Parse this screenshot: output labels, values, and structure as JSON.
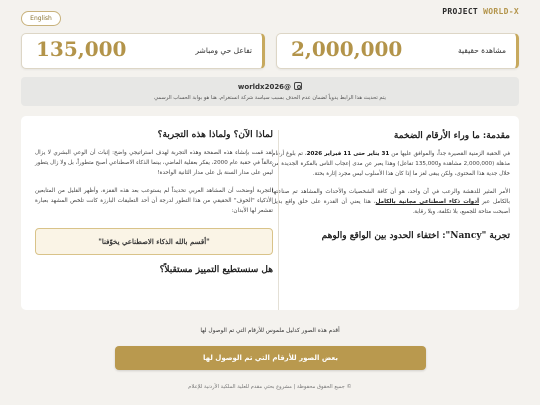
{
  "header": {
    "language_button": "English",
    "brand_part1": "PROJECT ",
    "brand_part2": "WORLD-X"
  },
  "stats": [
    {
      "number": "2,000,000",
      "label": "مشاهدة حقيقية"
    },
    {
      "number": "135,000",
      "label": "تفاعل حي ومباشر"
    }
  ],
  "instagram": {
    "handle": "worldx2026@",
    "note": "يتم تحديث هذا الرابط يدوياً لضمان عدم الحذف بسبب سياسة شركة انستغرام. هنا هو بوابة الحساب الرسمي"
  },
  "article": {
    "section1_title": "مقدمة: ما وراء الأرقام الضخمة",
    "section1_p1_a": "في الحقبة الزمنية القصيرة جداً، والموافق عليها من ",
    "section1_p1_date": "31 يناير حتى 11 فبراير 2026",
    "section1_p1_b": "، تم بلوغ أرقام مذهلة (2,000,000 مشاهدة و135,000 تفاعل) وهذا يعبر عن مدى إعجاب الناس بالفكرة الجديدة من خلال جدية هذا المحتوى، ولكن يبقى لغز ما إذا كان هذا الأسلوب ليس مجرد إثارة بحتة.",
    "section1_p2_a": "الأمر المثير للدهشة والرعب في آن واحد، هو أن كافة الشخصيات والأحداث والمشاهد تم صناعتها بالكامل عبر ",
    "section1_p2_tools": "أدوات ذكاء اصطناعي مجانية بالكامل",
    "section1_p2_b": "، هذا يعني أن القدرة على خلق واقع بديل أصبحت متاحة للجميع، بلا تكلفة، وبلا رقابة.",
    "section2_title": "تجربة \"Nancy\": اختفاء الحدود بين الواقع والوهم",
    "section3_title": "لماذا الآن؟ ولماذا هذه التجربة؟",
    "section3_p1": "لقد قمت بإنشاء هذه الصفحة وهذه التجربة لهدف استراتيجي واضح: إثبات أن الوعي البشري لا يزال عالقاً في حقبة عام 2000، يفكر بعقلية الماضي، بينما الذكاء الاصطناعي أصبح متطوراً، بل ولا زال يتطور ليس على مدار السنة بل على مدار الثانية الواحدة!",
    "section3_p2": "التجربة أوضحت أن المشاهد العربي تحديداً لم يستوعب بعد هذه القفزة، وأظهر القليل من المتابعين الأذكياء \"الخوف\" الحقيقي من هذا التطور لدرجة أن أحد التعليقات البارزة كانت تلخص المشهد بعبارة تقشعر لها الأبدان:",
    "quote": "\"أقسم بالله الذكاء الاصطناعي يخوّفنا\"",
    "section4_title_partial": "هل سنستطيع التمييز مستقبلاً؟"
  },
  "bottom": {
    "prompt": "أقدم هذه الصور كدليل ملموس للأرقام التي تم الوصول لها",
    "cta": "بعض الصور للأرقام التي تم الوصول لها",
    "footer": "© جميع الحقوق محفوظة | مشروع بحثي مقدم للعلية الملكية الأردنية للإعلام"
  }
}
